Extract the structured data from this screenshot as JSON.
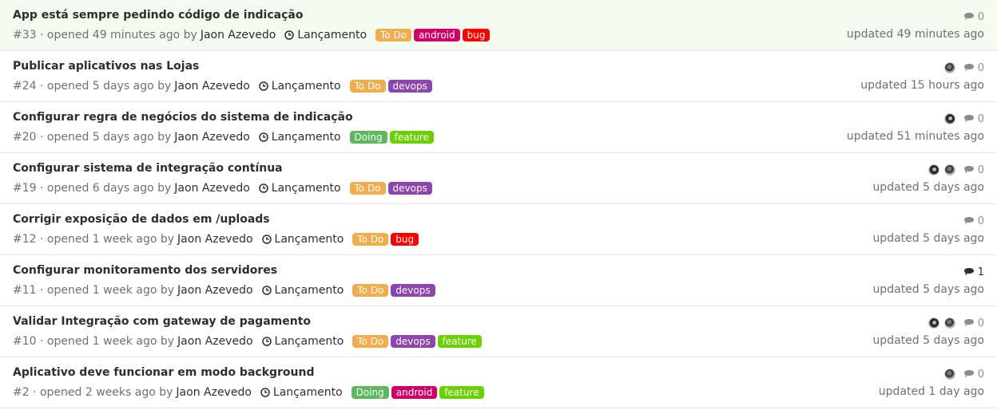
{
  "issues": [
    {
      "title": "App está sempre pedindo código de indicação",
      "ref": "#33",
      "opened_text": "· opened 49 minutes ago by",
      "author": "Jaon Azevedo",
      "milestone": "Lançamento",
      "labels": [
        {
          "text": "To Do",
          "color": "#f0ad4e"
        },
        {
          "text": "android",
          "color": "#d10069"
        },
        {
          "text": "bug",
          "color": "#ff0000"
        }
      ],
      "avatars": [],
      "comments": "0",
      "updated": "updated 49 minutes ago",
      "highlight": true
    },
    {
      "title": "Publicar aplicativos nas Lojas",
      "ref": "#24",
      "opened_text": "· opened 5 days ago by",
      "author": "Jaon Azevedo",
      "milestone": "Lançamento",
      "labels": [
        {
          "text": "To Do",
          "color": "#f0ad4e"
        },
        {
          "text": "devops",
          "color": "#8e44ad"
        }
      ],
      "avatars": [
        "a1"
      ],
      "comments": "0",
      "updated": "updated 15 hours ago"
    },
    {
      "title": "Configurar regra de negócios do sistema de indicação",
      "ref": "#20",
      "opened_text": "· opened 5 days ago by",
      "author": "Jaon Azevedo",
      "milestone": "Lançamento",
      "labels": [
        {
          "text": "Doing",
          "color": "#5cb85c"
        },
        {
          "text": "feature",
          "color": "#69d100"
        }
      ],
      "avatars": [
        "a2"
      ],
      "comments": "0",
      "updated": "updated 51 minutes ago"
    },
    {
      "title": "Configurar sistema de integração contínua",
      "ref": "#19",
      "opened_text": "· opened 6 days ago by",
      "author": "Jaon Azevedo",
      "milestone": "Lançamento",
      "labels": [
        {
          "text": "To Do",
          "color": "#f0ad4e"
        },
        {
          "text": "devops",
          "color": "#8e44ad"
        }
      ],
      "avatars": [
        "a2",
        "a1"
      ],
      "comments": "0",
      "updated": "updated 5 days ago"
    },
    {
      "title": "Corrigir exposição de dados em /uploads",
      "ref": "#12",
      "opened_text": "· opened 1 week ago by",
      "author": "Jaon Azevedo",
      "milestone": "Lançamento",
      "labels": [
        {
          "text": "To Do",
          "color": "#f0ad4e"
        },
        {
          "text": "bug",
          "color": "#ff0000"
        }
      ],
      "avatars": [],
      "comments": "0",
      "updated": "updated 5 days ago"
    },
    {
      "title": "Configurar monitoramento dos servidores",
      "ref": "#11",
      "opened_text": "· opened 1 week ago by",
      "author": "Jaon Azevedo",
      "milestone": "Lançamento",
      "labels": [
        {
          "text": "To Do",
          "color": "#f0ad4e"
        },
        {
          "text": "devops",
          "color": "#8e44ad"
        }
      ],
      "avatars": [],
      "comments": "1",
      "comments_active": true,
      "updated": "updated 5 days ago"
    },
    {
      "title": "Validar Integração com gateway de pagamento",
      "ref": "#10",
      "opened_text": "· opened 1 week ago by",
      "author": "Jaon Azevedo",
      "milestone": "Lançamento",
      "labels": [
        {
          "text": "To Do",
          "color": "#f0ad4e"
        },
        {
          "text": "devops",
          "color": "#8e44ad"
        },
        {
          "text": "feature",
          "color": "#69d100"
        }
      ],
      "avatars": [
        "a2",
        "a1"
      ],
      "comments": "0",
      "updated": "updated 5 days ago"
    },
    {
      "title": "Aplicativo deve funcionar em modo background",
      "ref": "#2",
      "opened_text": "· opened 2 weeks ago by",
      "author": "Jaon Azevedo",
      "milestone": "Lançamento",
      "labels": [
        {
          "text": "Doing",
          "color": "#5cb85c"
        },
        {
          "text": "android",
          "color": "#d10069"
        },
        {
          "text": "feature",
          "color": "#69d100"
        }
      ],
      "avatars": [
        "a1"
      ],
      "comments": "0",
      "updated": "updated 1 day ago"
    }
  ]
}
